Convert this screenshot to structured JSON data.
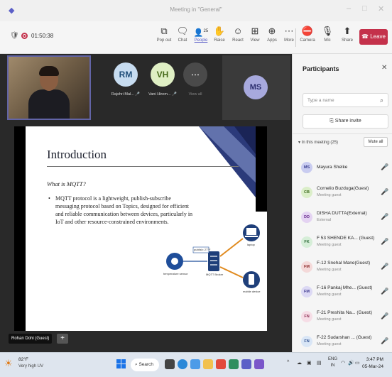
{
  "window": {
    "title": "Meeting in \"General\"",
    "min": "–",
    "max": "□",
    "close": "✕"
  },
  "toolbar": {
    "timer": "01:50:38",
    "buttons": [
      {
        "label": "Pop out",
        "icon": "pop-out-icon",
        "glyph": "⧉"
      },
      {
        "label": "Chat",
        "icon": "chat-icon",
        "glyph": "💬"
      },
      {
        "label": "People",
        "icon": "people-icon",
        "glyph": "👥",
        "count": "25"
      },
      {
        "label": "Raise",
        "icon": "raise-hand-icon",
        "glyph": "✋"
      },
      {
        "label": "React",
        "icon": "react-icon",
        "glyph": "☺"
      },
      {
        "label": "View",
        "icon": "view-icon",
        "glyph": "⊞"
      },
      {
        "label": "Apps",
        "icon": "apps-icon",
        "glyph": "⊕"
      },
      {
        "label": "More",
        "icon": "more-icon",
        "glyph": "⋯"
      }
    ],
    "media": [
      {
        "label": "Camera",
        "icon": "camera-off-icon",
        "glyph": "📷"
      },
      {
        "label": "Mic",
        "icon": "mic-off-icon",
        "glyph": "🎙"
      },
      {
        "label": "Share",
        "icon": "share-icon",
        "glyph": "⬆"
      }
    ],
    "leave": "Leave"
  },
  "stage": {
    "tiles": [
      {
        "initials": "RM",
        "name": "Rajshri Mal...",
        "bg": "#c7dcf0",
        "fg": "#1f4e79"
      },
      {
        "initials": "VH",
        "name": "Vani Hirem...",
        "bg": "#dfefc4",
        "fg": "#466a1a"
      }
    ],
    "view_all": "View all",
    "ms_initials": "MS",
    "presenter_chip": "Rohan Dohi (Guest)",
    "plus": "+"
  },
  "slide": {
    "title": "Introduction",
    "subtitle": "What is MQTT?",
    "bullet": "MQTT protocol is a lightweight, publish-subscribe messaging protocol based on Topics, designed for efficient and reliable communication between devices, particularly in IoT and other resource-constrained environments.",
    "diagram": {
      "sensor": "temperature sensor",
      "topic": "publish: 27°F",
      "broker": "MQTT Broker",
      "laptop": "laptop",
      "mobile": "mobile device"
    }
  },
  "panel": {
    "title": "Participants",
    "search_placeholder": "Type a name",
    "share_invite": "Share invite",
    "in_meeting": "In this meeting (25)",
    "mute_all": "Mute all",
    "people": [
      {
        "initials": "MS",
        "name": "Mayura Shelke",
        "role": "",
        "bg": "#c9ccf0",
        "fg": "#3b3f8f"
      },
      {
        "initials": "CB",
        "name": "Cornelio Buzduga(Guest)",
        "role": "Meeting guest",
        "bg": "#dbeec9",
        "fg": "#3d6b1f"
      },
      {
        "initials": "DD",
        "name": "DISHA DUTTA(External)",
        "role": "External",
        "bg": "#e4d3f2",
        "fg": "#6a2f8f"
      },
      {
        "initials": "FK",
        "name": "F 53 SHENDE KA... (Guest)",
        "role": "Meeting guest",
        "bg": "#d6eed8",
        "fg": "#2e6b3a"
      },
      {
        "initials": "FM",
        "name": "F-12 Snehal Mane(Guest)",
        "role": "Meeting guest",
        "bg": "#f4d9d9",
        "fg": "#8f2f2f"
      },
      {
        "initials": "FM",
        "name": "F-16 Pankaj Mhe... (Guest)",
        "role": "Meeting guest",
        "bg": "#dcd9f4",
        "fg": "#3f3a8f"
      },
      {
        "initials": "FN",
        "name": "F-21 Preshita Na... (Guest)",
        "role": "Meeting guest",
        "bg": "#f6dde6",
        "fg": "#8f2f55"
      },
      {
        "initials": "FN",
        "name": "F-22 Sudarshan ... (Guest)",
        "role": "Meeting guest",
        "bg": "#d9e6f6",
        "fg": "#2f4f8f"
      }
    ]
  },
  "taskbar": {
    "temp": "82°F",
    "weather": "Very high UV",
    "search": "Search",
    "lang1": "ENG",
    "lang2": "IN",
    "time": "3:47 PM",
    "date": "05-Mar-24"
  }
}
